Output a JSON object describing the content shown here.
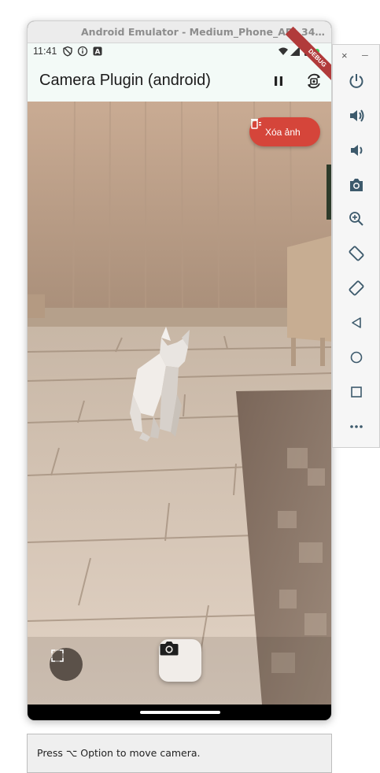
{
  "window": {
    "title": "Android Emulator - Medium_Phone_API_34-ex..."
  },
  "status_bar": {
    "time": "11:41"
  },
  "app_bar": {
    "title": "Camera Plugin (android)",
    "debug_ribbon": "DEBUG"
  },
  "actions": {
    "delete_label": "Xóa ảnh"
  },
  "toolbar": {
    "close": "×",
    "minimize": "–"
  },
  "hint": {
    "text": "Press ⌥ Option to move camera."
  },
  "colors": {
    "delete_button": "#d5453a",
    "app_bar_bg": "#f3faf7",
    "nav_bar": "#000000"
  },
  "icons": {
    "status": [
      "shield-icon",
      "info-icon",
      "a-badge-icon",
      "wifi-icon",
      "signal-icon",
      "battery-icon"
    ],
    "app_bar": [
      "pause-icon",
      "switch-camera-icon"
    ],
    "toolbar": [
      "power-icon",
      "volume-up-icon",
      "volume-down-icon",
      "camera-icon",
      "zoom-icon",
      "rotate-left-icon",
      "rotate-right-icon",
      "back-icon",
      "home-icon",
      "overview-icon",
      "more-icon"
    ]
  }
}
